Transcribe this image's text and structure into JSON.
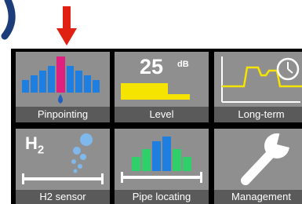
{
  "tiles": {
    "pinpointing": {
      "label": "Pinpointing",
      "icon": "pinpointing-bars-icon"
    },
    "level": {
      "label": "Level",
      "value": "25",
      "unit": "dB",
      "icon": "level-meter-icon"
    },
    "long_term": {
      "label": "Long-term",
      "icon": "clock-graph-icon"
    },
    "h2_sensor": {
      "label": "H2 sensor",
      "gas_symbol": "H",
      "gas_subscript": "2",
      "icon": "gas-bubbles-icon"
    },
    "pipe_locating": {
      "label": "Pipe locating",
      "icon": "pipe-locating-bars-icon"
    },
    "management": {
      "label": "Management",
      "icon": "wrench-icon"
    }
  },
  "colors": {
    "tile_bg": "#8f8f8f",
    "label_bg": "#5a5a5a",
    "accent_blue": "#1f5fbf",
    "accent_magenta": "#e0207f",
    "accent_yellow": "#f5e400",
    "accent_green": "#2fd06a",
    "pointer_red": "#e02010"
  }
}
